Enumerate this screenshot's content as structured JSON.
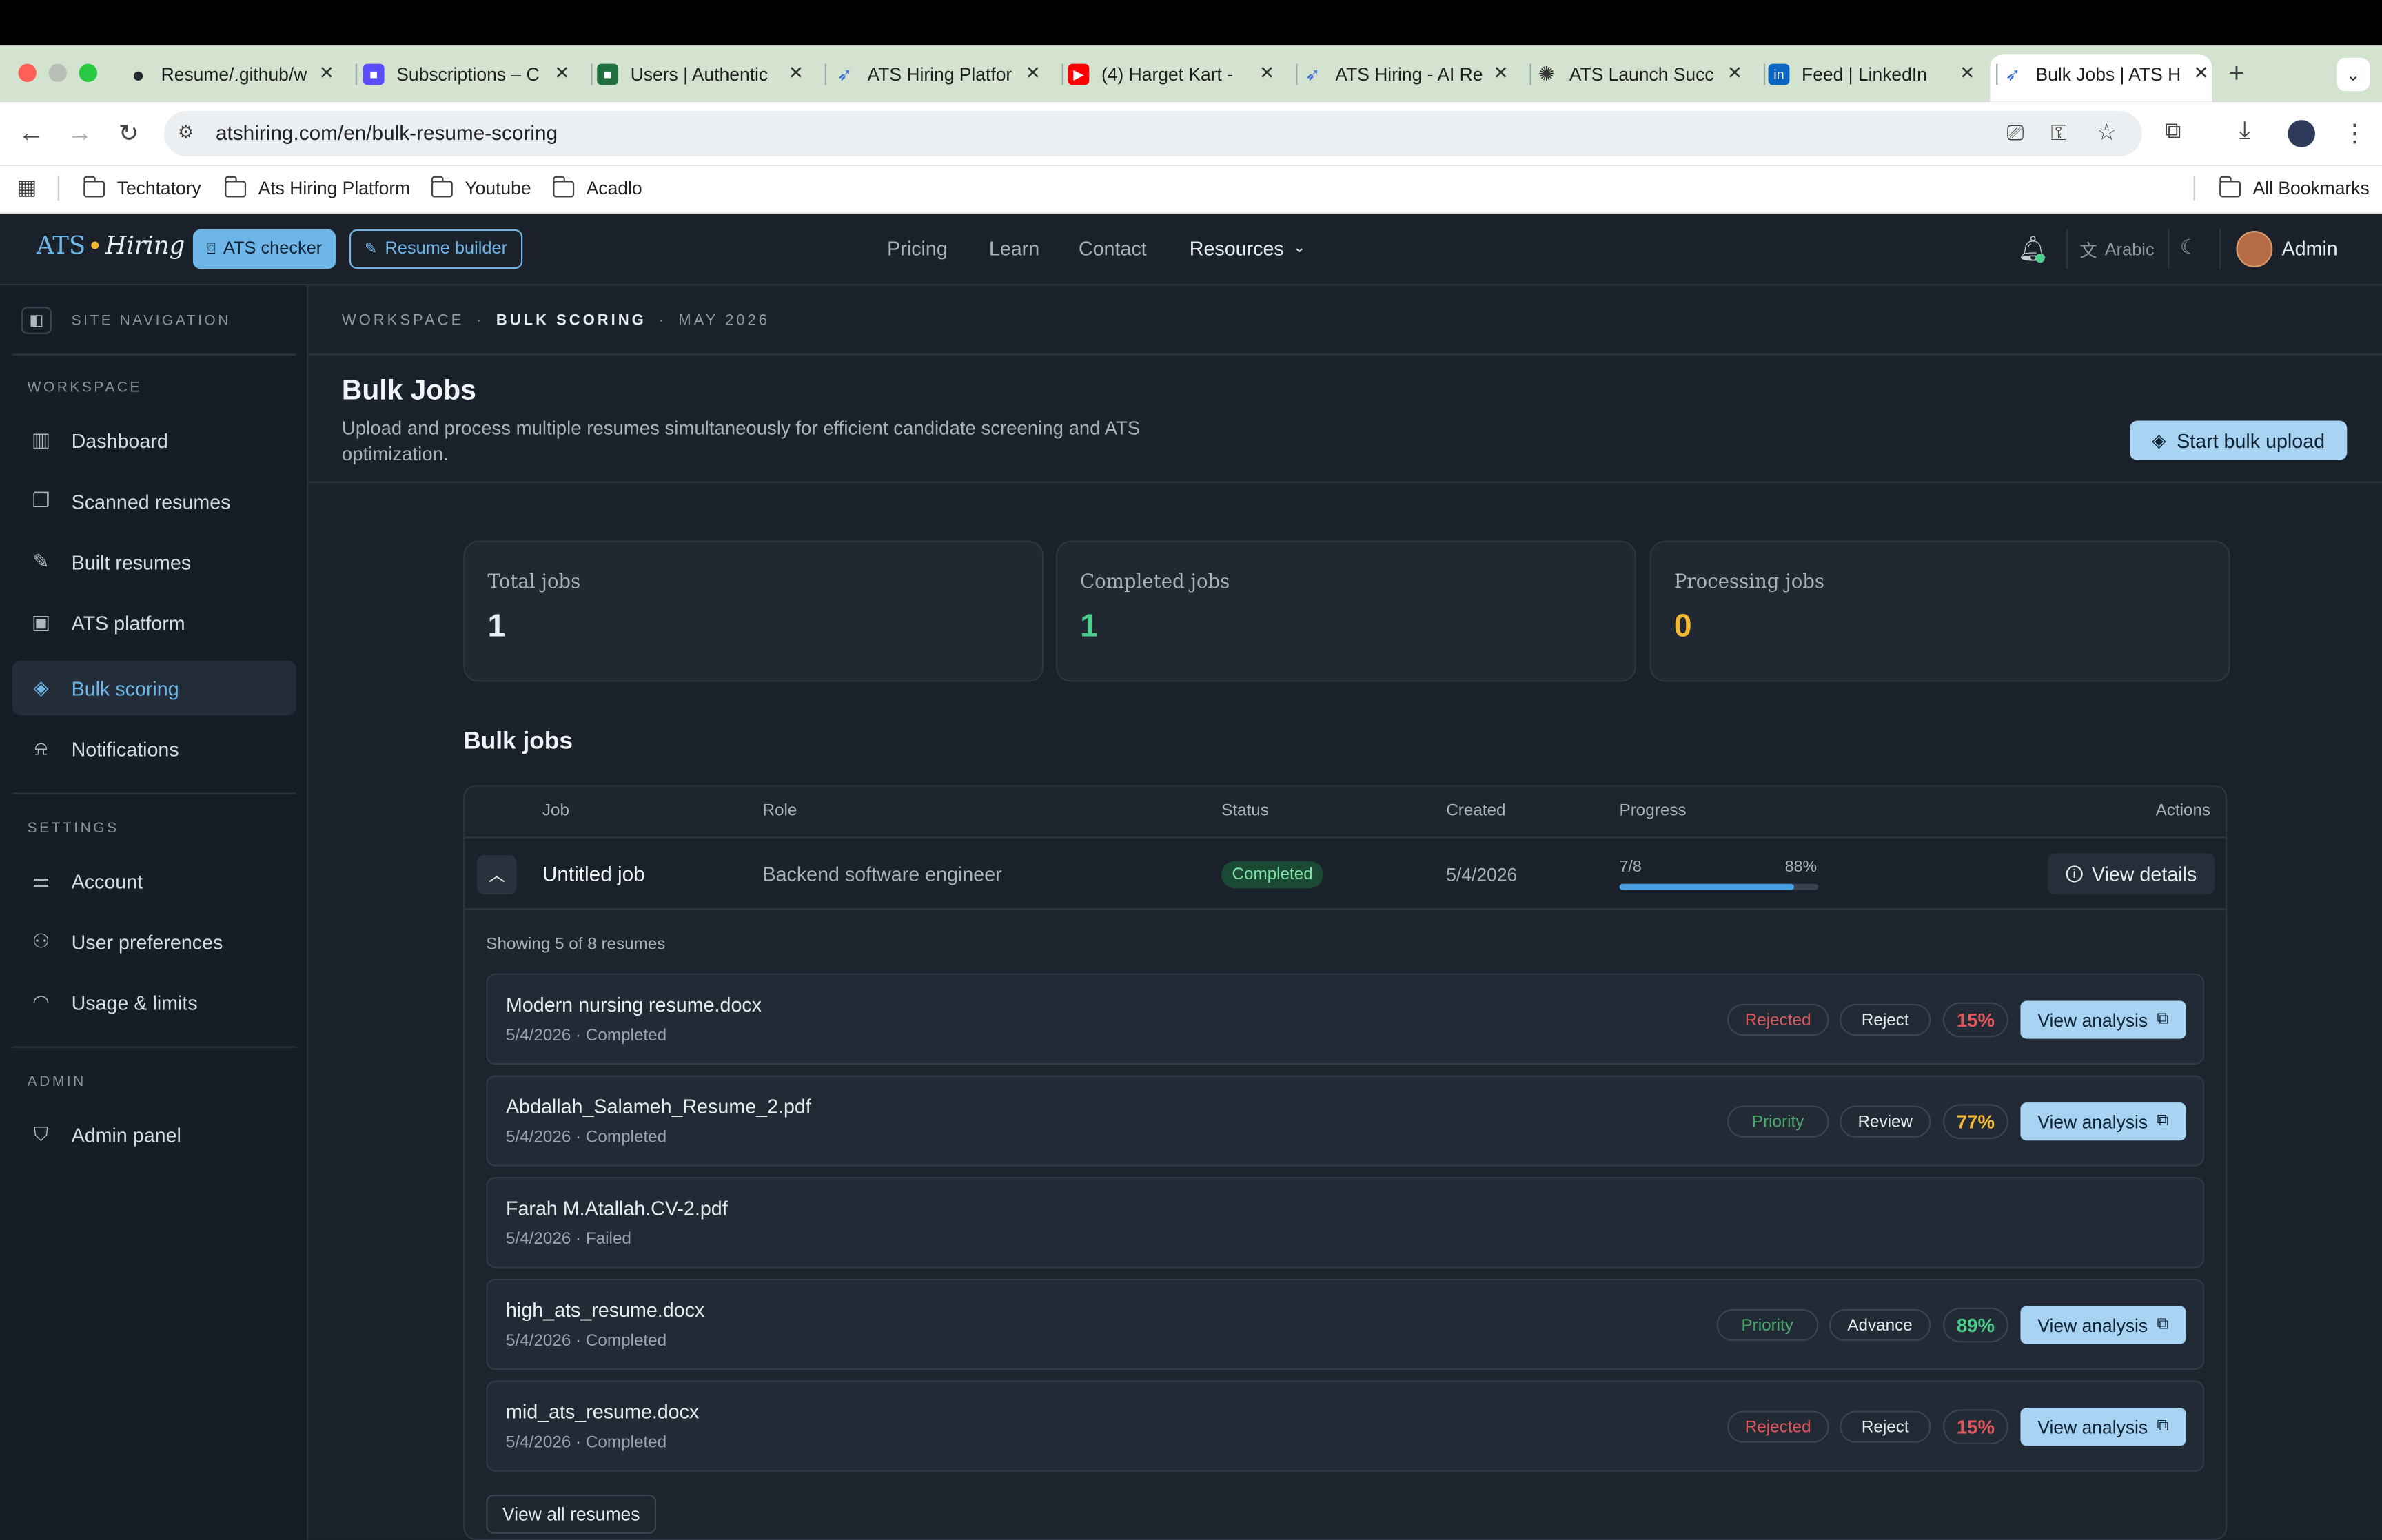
{
  "browser": {
    "tabs": [
      {
        "title": "Resume/.github/w",
        "icon": "github-icon",
        "color": "#24292f"
      },
      {
        "title": "Subscriptions – C",
        "icon": "app-icon",
        "color": "#5b4cff"
      },
      {
        "title": "Users | Authentic",
        "icon": "app-icon",
        "color": "#1f6f3f"
      },
      {
        "title": "ATS Hiring Platfor",
        "icon": "feather-icon",
        "color": "#3b6fd8"
      },
      {
        "title": "(4) Harget Kart -",
        "icon": "youtube-icon",
        "color": "#ff0000"
      },
      {
        "title": "ATS Hiring - AI Re",
        "icon": "feather-icon",
        "color": "#3b6fd8"
      },
      {
        "title": "ATS Launch Succ",
        "icon": "openai-icon",
        "color": "#333333"
      },
      {
        "title": "Feed | LinkedIn",
        "icon": "linkedin-icon",
        "color": "#0a66c2"
      },
      {
        "title": "Bulk Jobs | ATS H",
        "icon": "feather-icon",
        "color": "#3b6fd8"
      }
    ],
    "url": "atshiring.com/en/bulk-resume-scoring",
    "bookmarks": [
      "Techtatory",
      "Ats Hiring Platform",
      "Youtube",
      "Acadlo"
    ],
    "all_bookmarks": "All Bookmarks"
  },
  "header": {
    "logo_left": "ATS",
    "logo_right": "Hiring",
    "ats_checker": "ATS checker",
    "resume_builder": "Resume builder",
    "nav": [
      "Pricing",
      "Learn",
      "Contact",
      "Resources"
    ],
    "language": "Arabic",
    "user": "Admin"
  },
  "sidebar": {
    "title": "SITE NAVIGATION",
    "workspace_label": "WORKSPACE",
    "workspace": [
      {
        "label": "Dashboard",
        "icon": "bar-chart-icon"
      },
      {
        "label": "Scanned resumes",
        "icon": "copy-icon"
      },
      {
        "label": "Built resumes",
        "icon": "edit-file-icon"
      },
      {
        "label": "ATS platform",
        "icon": "briefcase-icon"
      },
      {
        "label": "Bulk scoring",
        "icon": "layers-icon",
        "active": true
      },
      {
        "label": "Notifications",
        "icon": "bell-icon"
      }
    ],
    "settings_label": "SETTINGS",
    "settings": [
      {
        "label": "Account",
        "icon": "sliders-icon"
      },
      {
        "label": "User preferences",
        "icon": "user-gear-icon"
      },
      {
        "label": "Usage & limits",
        "icon": "gauge-icon"
      }
    ],
    "admin_label": "ADMIN",
    "admin": [
      {
        "label": "Admin panel",
        "icon": "shield-icon"
      }
    ]
  },
  "breadcrumb": {
    "a": "WORKSPACE",
    "b": "BULK SCORING",
    "c": "MAY 2026"
  },
  "page": {
    "title": "Bulk Jobs",
    "subtitle_1": "Upload and process multiple resumes simultaneously for efficient candidate screening and ATS",
    "subtitle_2": "optimization.",
    "start_button": "Start bulk upload"
  },
  "stats": [
    {
      "label": "Total jobs",
      "value": "1",
      "color": "#e8edf2"
    },
    {
      "label": "Completed jobs",
      "value": "1",
      "color": "#4ccf8a"
    },
    {
      "label": "Processing jobs",
      "value": "0",
      "color": "#f4b731"
    }
  ],
  "jobs": {
    "heading": "Bulk jobs",
    "columns": {
      "job": "Job",
      "role": "Role",
      "status": "Status",
      "created": "Created",
      "progress": "Progress",
      "actions": "Actions"
    },
    "row": {
      "job": "Untitled job",
      "role": "Backend software engineer",
      "status": "Completed",
      "created": "5/4/2026",
      "progress_count": "7/8",
      "progress_pct": "88%",
      "progress_value": 0.88,
      "action": "View details"
    },
    "showing": "Showing 5 of 8 resumes",
    "resumes": [
      {
        "name": "Modern nursing resume.docx",
        "sub": "5/4/2026 · Completed",
        "tag": "Rejected",
        "tag_color": "#e0565b",
        "decision": "Reject",
        "score": "15%",
        "score_color": "#e0565b",
        "button": "View analysis"
      },
      {
        "name": "Abdallah_Salameh_Resume_2.pdf",
        "sub": "5/4/2026 · Completed",
        "tag": "Priority",
        "tag_color": "#4aa86a",
        "decision": "Review",
        "score": "77%",
        "score_color": "#f4b731",
        "button": "View analysis"
      },
      {
        "name": "Farah M.Atallah.CV-2.pdf",
        "sub": "5/4/2026 · Failed"
      },
      {
        "name": "high_ats_resume.docx",
        "sub": "5/4/2026 · Completed",
        "tag": "Priority",
        "tag_color": "#4aa86a",
        "decision": "Advance",
        "score": "89%",
        "score_color": "#4ccf8a",
        "button": "View analysis"
      },
      {
        "name": "mid_ats_resume.docx",
        "sub": "5/4/2026 · Completed",
        "tag": "Rejected",
        "tag_color": "#e0565b",
        "decision": "Reject",
        "score": "15%",
        "score_color": "#e0565b",
        "button": "View analysis"
      }
    ],
    "view_all": "View all resumes"
  }
}
